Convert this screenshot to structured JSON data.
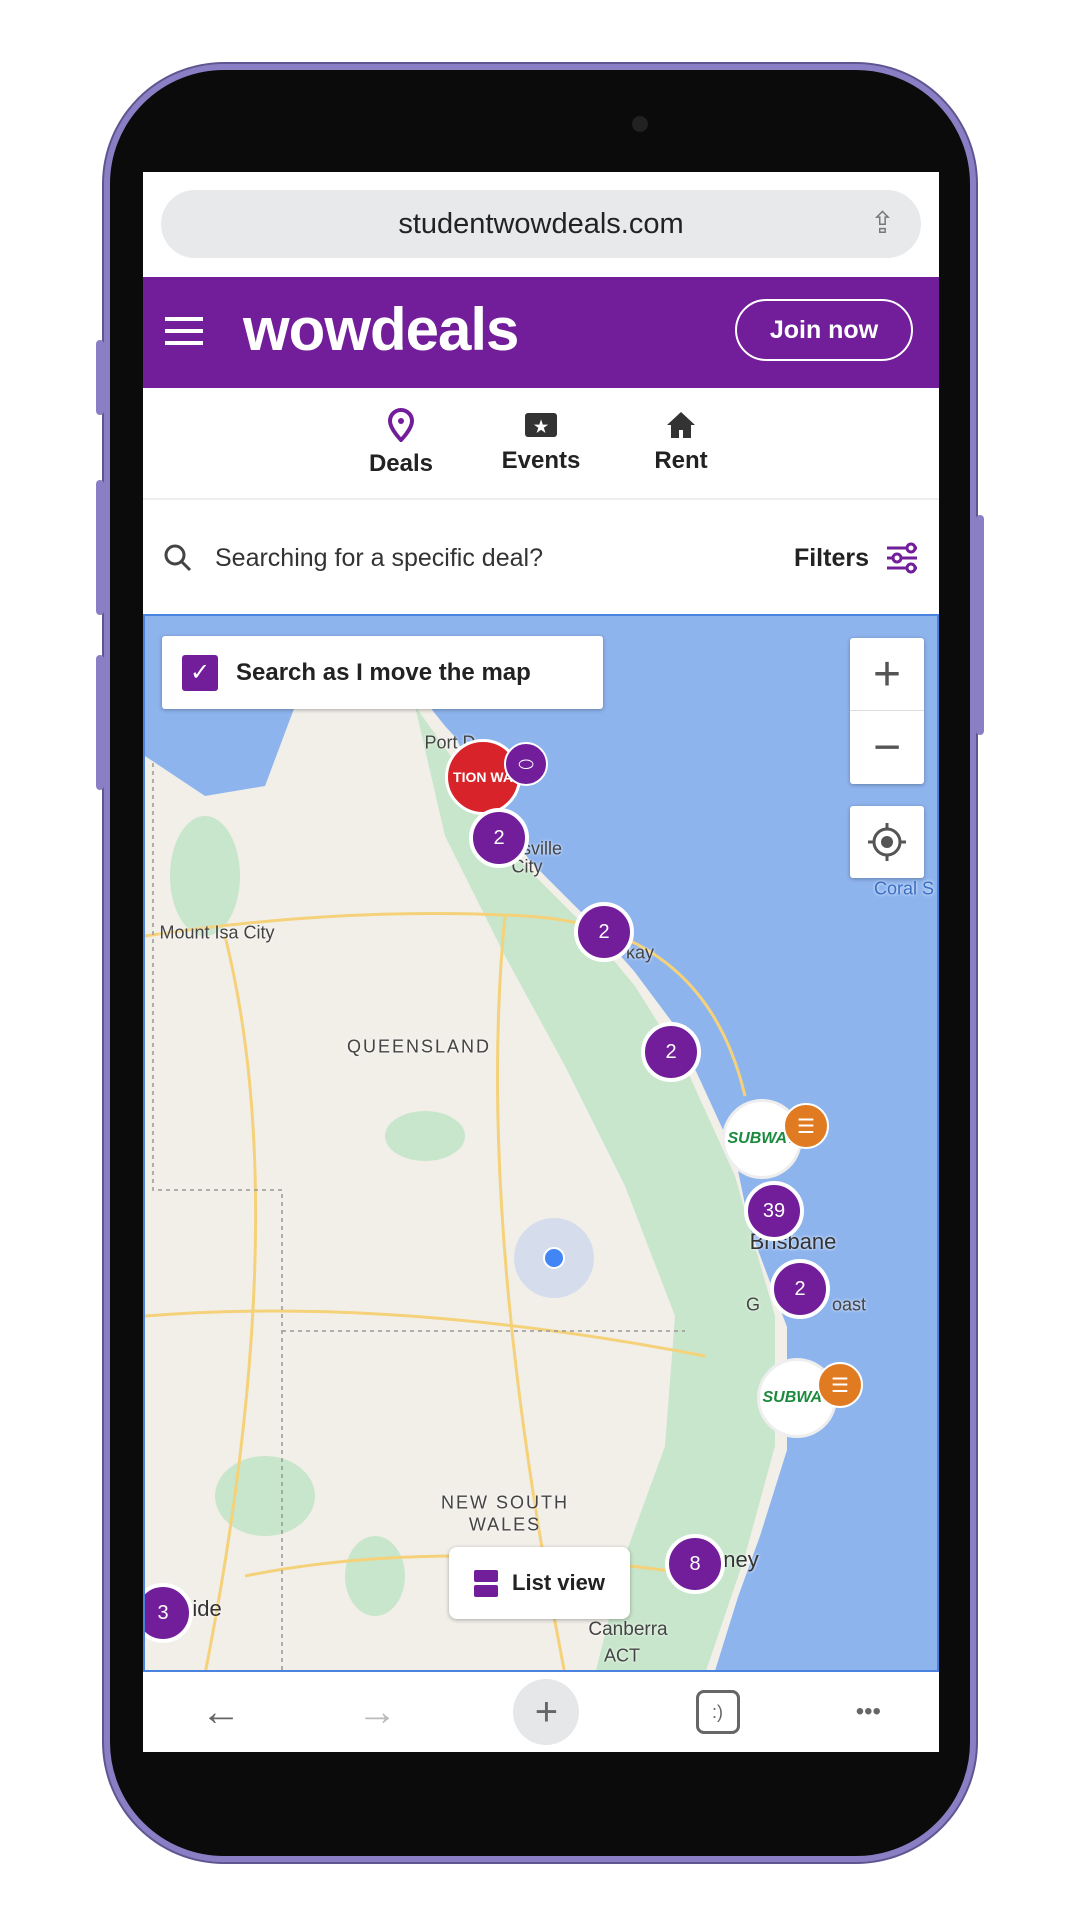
{
  "browser": {
    "url": "studentwowdeals.com",
    "share_icon": "share-icon"
  },
  "header": {
    "logo": "wowdeals",
    "join_label": "Join now",
    "menu_icon": "hamburger-icon"
  },
  "nav": [
    {
      "label": "Deals",
      "icon": "map-pin-icon",
      "active": true
    },
    {
      "label": "Events",
      "icon": "ticket-icon"
    },
    {
      "label": "Rent",
      "icon": "home-icon"
    }
  ],
  "search": {
    "placeholder": "Searching for a specific deal?",
    "filters_label": "Filters"
  },
  "map": {
    "search_as_move_label": "Search as I move the map",
    "search_as_move_checked": true,
    "zoom_in": "+",
    "zoom_out": "−",
    "list_view_label": "List view",
    "labels": [
      "Port D",
      "sville",
      "City",
      "Mount Isa City",
      "QUEENSLAND",
      "kay",
      "Brisbane",
      "G",
      "oast",
      "Coral S",
      "NEW SOUTH",
      "WALES",
      "ney",
      "Canberra",
      "ACT",
      "ide"
    ],
    "clusters": [
      "2",
      "2",
      "2",
      "39",
      "2",
      "8",
      "3"
    ],
    "brand_markers": [
      "TION WA",
      "SUBWAY",
      "SUBWAY"
    ]
  },
  "colors": {
    "brand": "#721e9a",
    "ocean": "#8eb4ee",
    "land": "#f2efe9"
  },
  "bottom": {
    "back": "←",
    "forward": "→",
    "new_tab": "+",
    "tabs": ":)",
    "more": "•••"
  }
}
